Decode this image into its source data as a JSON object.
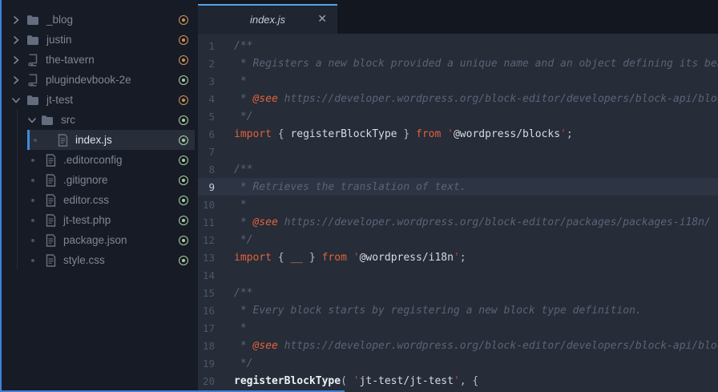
{
  "colors": {
    "accent_blue": "#3f82d6",
    "tab_border_blue": "#57a3e6",
    "selection_bar_blue": "#3e8bd8",
    "target_orange": "#cf9255",
    "target_green": "#a9cf9f",
    "keyword_orange": "#e2623b"
  },
  "sidebar": {
    "items": [
      {
        "label": "_blog",
        "kind": "folder",
        "marker": "chevron-right",
        "target": "orange",
        "cls": "lvl0",
        "selected": false
      },
      {
        "label": "justin",
        "kind": "folder",
        "marker": "chevron-right",
        "target": "orange",
        "cls": "lvl0",
        "selected": false
      },
      {
        "label": "the-tavern",
        "kind": "repo",
        "marker": "chevron-right",
        "target": "orange",
        "cls": "lvl0",
        "selected": false
      },
      {
        "label": "plugindevbook-2e",
        "kind": "repo",
        "marker": "chevron-right",
        "target": "green",
        "cls": "lvl0",
        "selected": false
      },
      {
        "label": "jt-test",
        "kind": "folder",
        "marker": "chevron-down",
        "target": "orange",
        "cls": "lvl0",
        "selected": false
      },
      {
        "label": "src",
        "kind": "folder",
        "marker": "chevron-down",
        "target": "green",
        "cls": "lvl-src",
        "selected": false
      },
      {
        "label": "index.js",
        "kind": "file",
        "marker": "dot",
        "target": "green",
        "cls": "lvl-index",
        "selected": true
      },
      {
        "label": ".editorconfig",
        "kind": "file",
        "marker": "dot",
        "target": "green",
        "cls": "lvl-file",
        "selected": false
      },
      {
        "label": ".gitignore",
        "kind": "file",
        "marker": "dot",
        "target": "green",
        "cls": "lvl-file",
        "selected": false
      },
      {
        "label": "editor.css",
        "kind": "file",
        "marker": "dot",
        "target": "green",
        "cls": "lvl-file",
        "selected": false
      },
      {
        "label": "jt-test.php",
        "kind": "file",
        "marker": "dot",
        "target": "green",
        "cls": "lvl-file",
        "selected": false
      },
      {
        "label": "package.json",
        "kind": "file",
        "marker": "dot",
        "target": "green",
        "cls": "lvl-file",
        "selected": false
      },
      {
        "label": "style.css",
        "kind": "file",
        "marker": "dot",
        "target": "green",
        "cls": "lvl-file",
        "selected": false
      }
    ]
  },
  "editor": {
    "tab": {
      "label": "index.js",
      "close_glyph": "✕"
    },
    "lines": [
      {
        "n": "1",
        "current": false,
        "tokens": [
          {
            "t": "c",
            "s": "/**"
          }
        ]
      },
      {
        "n": "2",
        "current": false,
        "tokens": [
          {
            "t": "c",
            "s": " * Registers a new block provided a unique name and an object defining its behavior."
          }
        ]
      },
      {
        "n": "3",
        "current": false,
        "tokens": [
          {
            "t": "c",
            "s": " *"
          }
        ]
      },
      {
        "n": "4",
        "current": false,
        "tokens": [
          {
            "t": "c",
            "s": " * "
          },
          {
            "t": "tag",
            "s": "@see"
          },
          {
            "t": "c",
            "s": " https://developer.wordpress.org/block-editor/developers/block-api/block-registration/"
          }
        ]
      },
      {
        "n": "5",
        "current": false,
        "tokens": [
          {
            "t": "c",
            "s": " */"
          }
        ]
      },
      {
        "n": "6",
        "current": false,
        "tokens": [
          {
            "t": "k",
            "s": "import"
          },
          {
            "t": "p",
            "s": " { "
          },
          {
            "t": "i",
            "s": "registerBlockType"
          },
          {
            "t": "p",
            "s": " } "
          },
          {
            "t": "k",
            "s": "from"
          },
          {
            "t": "p",
            "s": " "
          },
          {
            "t": "q",
            "s": "'"
          },
          {
            "t": "s",
            "s": "@wordpress/blocks"
          },
          {
            "t": "q",
            "s": "'"
          },
          {
            "t": "p",
            "s": ";"
          }
        ]
      },
      {
        "n": "7",
        "current": false,
        "tokens": []
      },
      {
        "n": "8",
        "current": false,
        "tokens": [
          {
            "t": "c",
            "s": "/**"
          }
        ]
      },
      {
        "n": "9",
        "current": true,
        "tokens": [
          {
            "t": "c",
            "s": " * Retrieves the translation of text."
          }
        ]
      },
      {
        "n": "10",
        "current": false,
        "tokens": [
          {
            "t": "c",
            "s": " *"
          }
        ]
      },
      {
        "n": "11",
        "current": false,
        "tokens": [
          {
            "t": "c",
            "s": " * "
          },
          {
            "t": "tag",
            "s": "@see"
          },
          {
            "t": "c",
            "s": " https://developer.wordpress.org/block-editor/packages/packages-i18n/"
          }
        ]
      },
      {
        "n": "12",
        "current": false,
        "tokens": [
          {
            "t": "c",
            "s": " */"
          }
        ]
      },
      {
        "n": "13",
        "current": false,
        "tokens": [
          {
            "t": "k",
            "s": "import"
          },
          {
            "t": "p",
            "s": " { "
          },
          {
            "t": "u",
            "s": "__"
          },
          {
            "t": "p",
            "s": " } "
          },
          {
            "t": "k",
            "s": "from"
          },
          {
            "t": "p",
            "s": " "
          },
          {
            "t": "q",
            "s": "'"
          },
          {
            "t": "s",
            "s": "@wordpress/i18n"
          },
          {
            "t": "q",
            "s": "'"
          },
          {
            "t": "p",
            "s": ";"
          }
        ]
      },
      {
        "n": "14",
        "current": false,
        "tokens": []
      },
      {
        "n": "15",
        "current": false,
        "tokens": [
          {
            "t": "c",
            "s": "/**"
          }
        ]
      },
      {
        "n": "16",
        "current": false,
        "tokens": [
          {
            "t": "c",
            "s": " * Every block starts by registering a new block type definition."
          }
        ]
      },
      {
        "n": "17",
        "current": false,
        "tokens": [
          {
            "t": "c",
            "s": " *"
          }
        ]
      },
      {
        "n": "18",
        "current": false,
        "tokens": [
          {
            "t": "c",
            "s": " * "
          },
          {
            "t": "tag",
            "s": "@see"
          },
          {
            "t": "c",
            "s": " https://developer.wordpress.org/block-editor/developers/block-api/block-registration/"
          }
        ]
      },
      {
        "n": "19",
        "current": false,
        "tokens": [
          {
            "t": "c",
            "s": " */"
          }
        ]
      },
      {
        "n": "20",
        "current": false,
        "tokens": [
          {
            "t": "f",
            "s": "registerBlockType"
          },
          {
            "t": "p",
            "s": "( "
          },
          {
            "t": "q",
            "s": "'"
          },
          {
            "t": "s",
            "s": "jt-test/jt-test"
          },
          {
            "t": "q",
            "s": "'"
          },
          {
            "t": "p",
            "s": ", {"
          }
        ]
      }
    ]
  }
}
